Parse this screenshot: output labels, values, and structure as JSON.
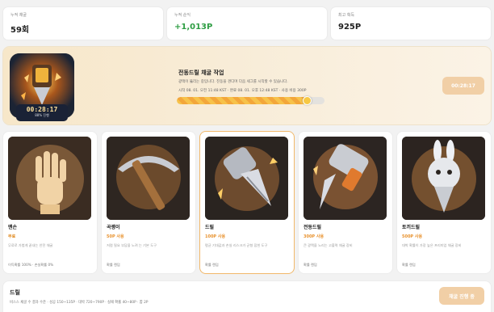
{
  "stats": [
    {
      "label": "누적 채굴",
      "value": "59회"
    },
    {
      "label": "누적 순익",
      "value": "+1,013P"
    },
    {
      "label": "최고 획득",
      "value": "925P"
    }
  ],
  "job": {
    "timer": "00:28:17",
    "timer_sub": "88% 진행",
    "title": "전동드릴 채굴 작업",
    "desc": "광맥이 뚫리는 중입니다. 진동을 견디며 다음 세그를 시작할 수 있습니다.",
    "meta": "시작 08. 01. 오전 11:48 KST · 완료 08. 01. 오후 12:48 KST · 사용 비용 300P",
    "progress": 0.88,
    "button_label": "00:28:17"
  },
  "tools": [
    {
      "name": "맨손",
      "price": "무료",
      "desc": "무료로 가볍게 끝내는 안전 채굴",
      "foot": "이득확률 100% · 손실확률 0%"
    },
    {
      "name": "곡괭이",
      "price": "50P 사용",
      "desc": "저렴 필요 부담을 노려 는 기본 도구",
      "foot": "확률 랜덤"
    },
    {
      "name": "드릴",
      "price": "100P 사용",
      "desc": "평균 기대값과 손실 리스크가 균형 잡힌 도구",
      "foot": "확률 랜덤"
    },
    {
      "name": "전동드릴",
      "price": "300P 사용",
      "desc": "큰 광맥을 노리는 고출력 채굴 장비",
      "foot": "확률 랜덤"
    },
    {
      "name": "토끼드릴",
      "price": "500P 사용",
      "desc": "대박 확률이 가장 높은 프리미엄 채굴 장비",
      "foot": "확률 랜덤"
    }
  ],
  "selected": {
    "name": "드릴",
    "desc": "비스스 채굴 수 결과 수준 · 성공 150~135P · 대박 720~790P · 실패 확률 40~80P · 뽑 2P",
    "button_label": "채굴 진행 중"
  },
  "colors": {
    "accent": "#f1cfa6",
    "orange": "#e8922e",
    "green": "#2f9e44",
    "dark": "#1a2236"
  }
}
